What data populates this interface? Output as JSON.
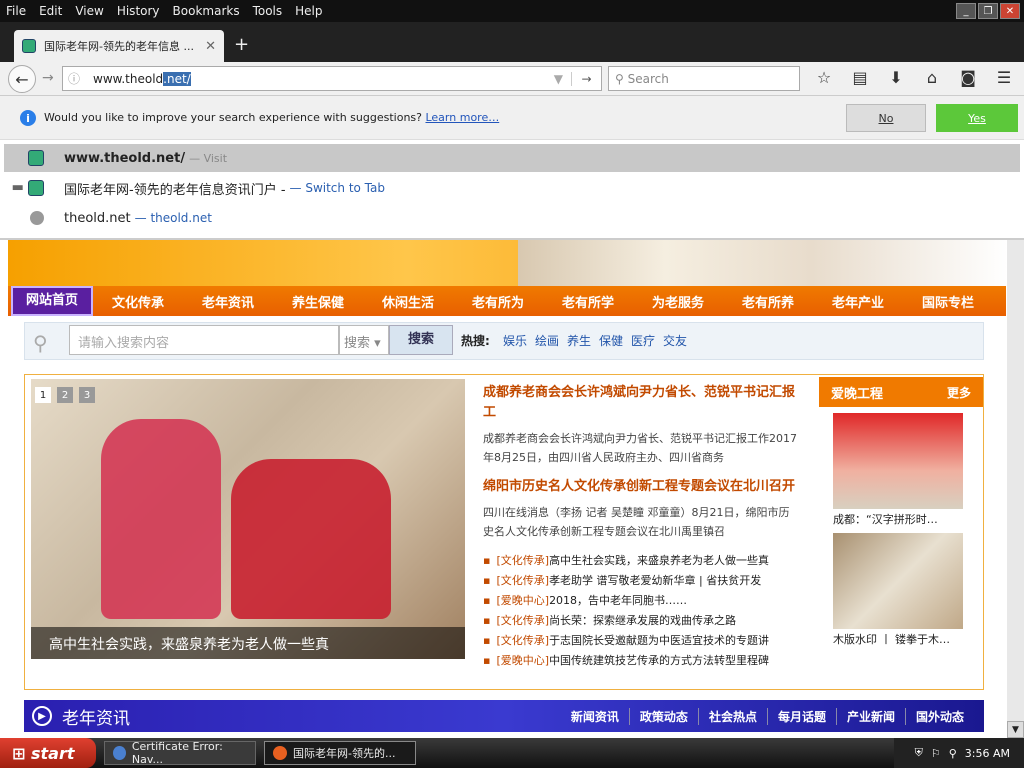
{
  "menubar": {
    "items": [
      "File",
      "Edit",
      "View",
      "History",
      "Bookmarks",
      "Tools",
      "Help"
    ]
  },
  "tab": {
    "title": "国际老年网-领先的老年信息 ..."
  },
  "nav": {
    "url_prefix": "www.theold",
    "url_selected": ".net/",
    "search_placeholder": "Search"
  },
  "notification": {
    "text": "Would you like to improve your search experience with suggestions?",
    "link": "Learn more…",
    "no": "No",
    "yes": "Yes"
  },
  "suggestions": [
    {
      "title": "www.theold.net/",
      "action": "— Visit"
    },
    {
      "title": "国际老年网-领先的老年信息资讯门户 -",
      "action": "— Switch to Tab"
    },
    {
      "title": "theold.net",
      "action": "— theold.net"
    }
  ],
  "site": {
    "nav": [
      "网站首页",
      "文化传承",
      "老年资讯",
      "养生保健",
      "休闲生活",
      "老有所为",
      "老有所学",
      "为老服务",
      "老有所养",
      "老年产业",
      "国际专栏"
    ],
    "search": {
      "placeholder": "请输入搜索内容",
      "select": "搜索",
      "button": "搜索",
      "hot_label": "热搜:",
      "hot": [
        "娱乐",
        "绘画",
        "养生",
        "保健",
        "医疗",
        "交友"
      ]
    },
    "slide": {
      "caption": "高中生社会实践，来盛泉养老为老人做一些真",
      "pages": [
        "1",
        "2",
        "3"
      ]
    },
    "news": [
      {
        "title": "成都养老商会会长许鸿斌向尹力省长、范锐平书记汇报工",
        "body": "成都养老商会会长许鸿斌向尹力省长、范锐平书记汇报工作2017年8月25日，由四川省人民政府主办、四川省商务"
      },
      {
        "title": "绵阳市历史名人文化传承创新工程专题会议在北川召开",
        "body": "四川在线消息（李扬 记者 吴楚瞳 邓童童）8月21日，绵阳市历史名人文化传承创新工程专题会议在北川禹里镇召"
      }
    ],
    "list": [
      {
        "cat": "[文化传承]",
        "text": "高中生社会实践，来盛泉养老为老人做一些真"
      },
      {
        "cat": "[文化传承]",
        "text": "孝老助学 谱写敬老爱幼新华章 | 省扶贫开发"
      },
      {
        "cat": "[爱晚中心]",
        "text": "2018，告中老年同胞书……"
      },
      {
        "cat": "[文化传承]",
        "text": "尚长荣：探索继承发展的戏曲传承之路"
      },
      {
        "cat": "[文化传承]",
        "text": "于志国院长受邀献题为中医适宜技术的专题讲"
      },
      {
        "cat": "[爱晚中心]",
        "text": "中国传统建筑技艺传承的方式方法转型里程碑"
      }
    ],
    "side": {
      "title": "爱晚工程",
      "more": "更多",
      "cap1": "成都：“汉字拼形时…",
      "cap2": "木版水印 丨 镂拳于木…"
    },
    "section": {
      "title": "老年资讯",
      "links": [
        "新闻资讯",
        "政策动态",
        "社会热点",
        "每月话题",
        "产业新闻",
        "国外动态"
      ]
    }
  },
  "taskbar": {
    "start": "start",
    "items": [
      "Certificate Error: Nav...",
      "国际老年网-领先的..."
    ],
    "time": "3:56 AM"
  }
}
